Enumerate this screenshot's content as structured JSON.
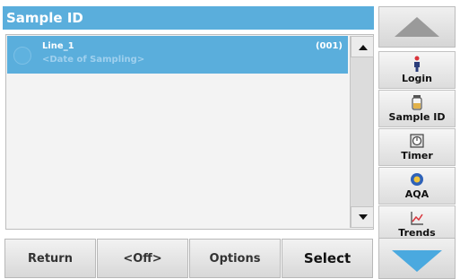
{
  "header": {
    "title": "Sample ID"
  },
  "list": {
    "rows": [
      {
        "name": "Line_1",
        "date": "<Date of Sampling>",
        "count": "(001)"
      }
    ]
  },
  "bottom_bar": {
    "return_label": "Return",
    "off_label": "<Off>",
    "options_label": "Options",
    "select_label": "Select"
  },
  "side_panel": {
    "login_label": "Login",
    "sample_id_label": "Sample ID",
    "timer_label": "Timer",
    "aqa_label": "AQA",
    "trends_label": "Trends"
  },
  "colors": {
    "accent": "#5aaedc",
    "scroll_arrow_down": "#4aa9df"
  }
}
